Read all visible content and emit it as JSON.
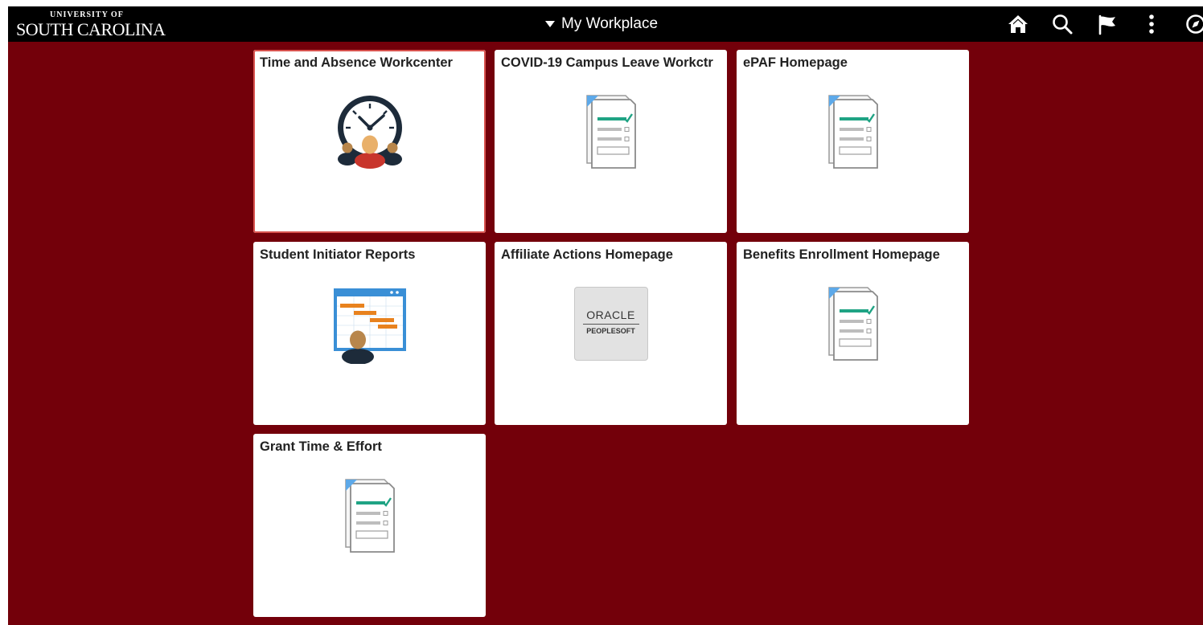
{
  "header": {
    "logo_top": "UNIVERSITY OF",
    "logo_main": "SOUTH CAROLINA",
    "title": "My Workplace",
    "icons": [
      "home-icon",
      "search-icon",
      "flag-icon",
      "more-options-icon",
      "navbar-compass-icon"
    ]
  },
  "tiles": [
    {
      "title": "Time and Absence Workcenter",
      "icon": "clock-people-icon",
      "selected": true
    },
    {
      "title": "COVID-19 Campus Leave Workctr",
      "icon": "form-document-icon"
    },
    {
      "title": "ePAF Homepage",
      "icon": "form-document-icon"
    },
    {
      "title": "Student Initiator Reports",
      "icon": "report-schedule-icon"
    },
    {
      "title": "Affiliate Actions Homepage",
      "icon": "oracle-peoplesoft-icon",
      "logo_word": "ORACLE",
      "logo_sub": "PEOPLESOFT"
    },
    {
      "title": "Benefits Enrollment Homepage",
      "icon": "form-document-icon"
    },
    {
      "title": "Grant Time & Effort",
      "icon": "form-document-icon"
    }
  ],
  "colors": {
    "background": "#73000a",
    "topbar": "#000000",
    "tile": "#ffffff",
    "selected_border": "#d9534f",
    "accent_green": "#1fa384"
  }
}
